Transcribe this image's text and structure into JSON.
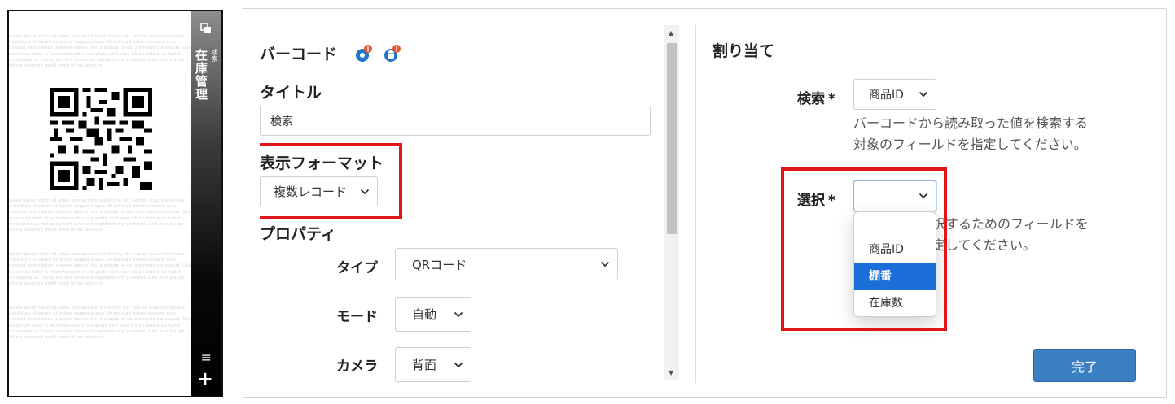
{
  "preview": {
    "app_title": "在庫管理",
    "app_subtitle": "検索",
    "lorem_blocks": [
      "Lorem ipsum dolor sit amet, consectetur adipiscing elit, sed do eiusmod tempor incididunt ut labore et dolore magna aliqua. Ut enim ad minim veniam, quis nostrud exercitation ullamco laboris nisi ut aliquip ex ea commodo consequat. Duis aute irure dolor in reprehenderit in voluptate velit esse cillum dolore eu fugiat nulla pariatur. Excepteur sint occaecat cupidatat non proident, sunt in culpa qui officia deserunt mollit anim id est laborum.",
      "Lorem ipsum dolor sit amet, consectetur adipiscing elit, sed do eiusmod tempor incididunt ut labore et dolore magna aliqua. Ut enim ad minim veniam, quis nostrud exercitation ullamco laboris nisi ut aliquip ex ea commodo consequat. Duis aute irure dolor in reprehenderit in voluptate velit esse cillum dolore eu fugiat nulla pariatur. Excepteur sint occaecat cupidatat non proident, sunt in culpa qui officia deserunt mollit anim id est laborum.",
      "Lorem ipsum dolor sit amet, consectetur adipiscing elit, sed do eiusmod tempor incididunt ut labore et dolore magna aliqua. Ut enim ad minim veniam, quis nostrud exercitation ullamco laboris nisi ut aliquip ex ea commodo consequat. Duis aute irure dolor in reprehenderit in voluptate velit esse cillum dolore eu fugiat nulla pariatur. Excepteur sint occaecat cupidatat non proident, sunt in culpa qui officia deserunt mollit anim id est laborum.",
      "Lorem ipsum dolor sit amet, consectetur adipiscing elit, sed do eiusmod tempor incididunt ut labore et dolore magna aliqua. Ut enim ad minim veniam, quis nostrud exercitation ullamco laboris nisi ut aliquip ex ea commodo consequat. Duis aute irure dolor in reprehenderit in voluptate velit esse cillum dolore eu fugiat nulla pariatur. Excepteur sint occaecat cupidatat non proident, sunt in culpa qui officia deserunt mollit anim id est laborum."
    ],
    "menu_glyph": "≡",
    "add_glyph": "+"
  },
  "settings": {
    "section_title": "バーコード",
    "title_label": "タイトル",
    "title_value": "検索",
    "format_label": "表示フォーマット",
    "format_value": "複数レコード",
    "properties_label": "プロパティ",
    "type_label": "タイプ",
    "type_value": "QRコード",
    "mode_label": "モード",
    "mode_value": "自動",
    "camera_label": "カメラ",
    "camera_value": "背面"
  },
  "assign": {
    "title": "割り当て",
    "required_mark": "*",
    "search_label": "検索",
    "search_value": "商品ID",
    "search_help_1": "バーコードから読み取った値を検索する",
    "search_help_2": "対象のフィールドを指定してください。",
    "select_label": "選択",
    "select_value": "",
    "select_help_1": "選択するためのフィールドを",
    "select_help_2": "指定してください。",
    "options": [
      "商品ID",
      "棚番",
      "在庫数"
    ],
    "selected_option": "棚番"
  },
  "actions": {
    "done": "完了"
  },
  "colors": {
    "primary": "#3a7fc1",
    "highlight": "#e0161b",
    "option_selected": "#1a6fd8",
    "badge": "#e8562a"
  }
}
